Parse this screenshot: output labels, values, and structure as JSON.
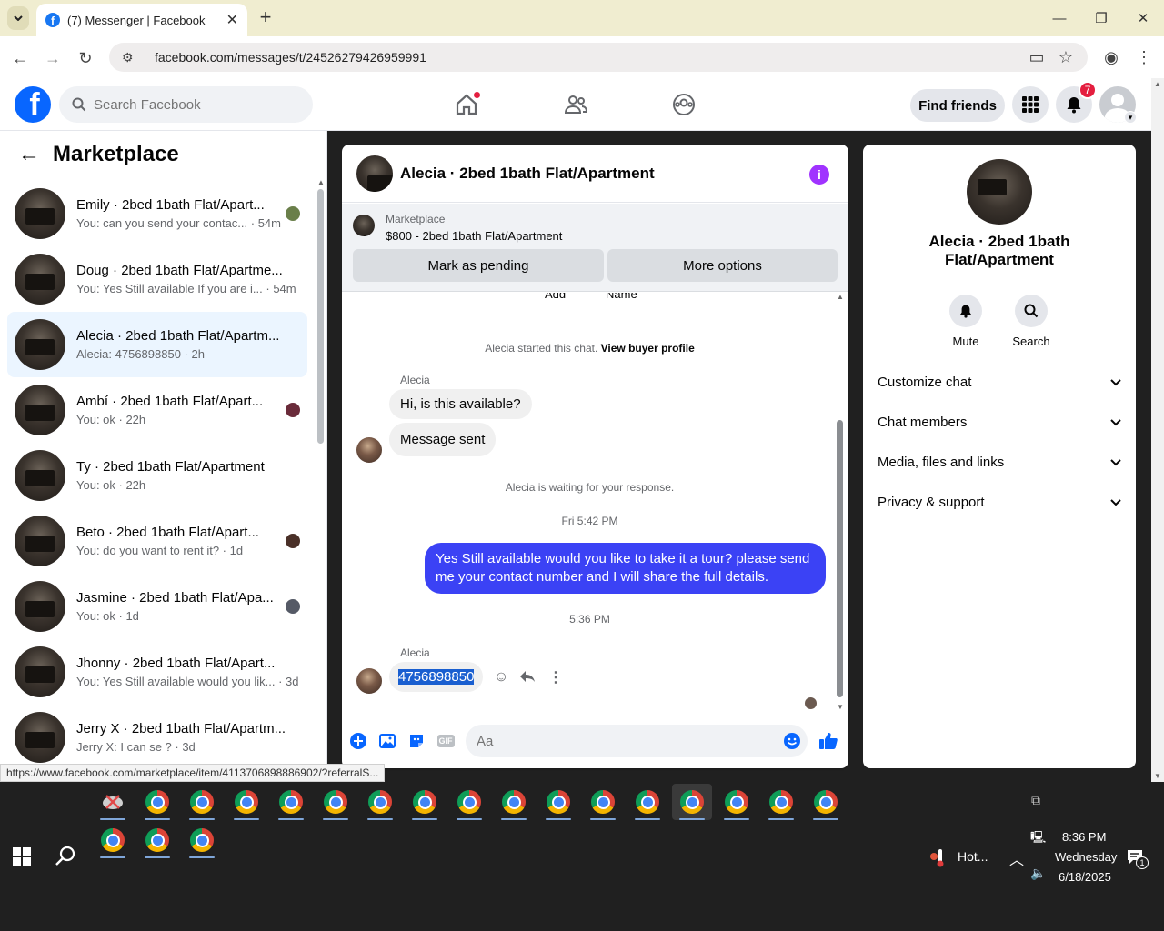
{
  "browser": {
    "tab_title": "(7) Messenger | Facebook",
    "url": "facebook.com/messages/t/24526279426959991",
    "status_url": "https://www.facebook.com/marketplace/item/4113706898886902/?referralS..."
  },
  "fb_header": {
    "search_placeholder": "Search Facebook",
    "find_friends": "Find friends",
    "notification_count": "7"
  },
  "sidebar": {
    "title": "Marketplace",
    "conversations": [
      {
        "name": "Emily · 2bed 1bath Flat/Apart...",
        "preview": "You: can you send your contac... · 54m"
      },
      {
        "name": "Doug · 2bed 1bath Flat/Apartme...",
        "preview": "You: Yes Still available If you are i... · 54m"
      },
      {
        "name": "Alecia · 2bed 1bath Flat/Apartm...",
        "preview": "Alecia: 4756898850 · 2h"
      },
      {
        "name": "Ambí · 2bed 1bath Flat/Apart...",
        "preview": "You: ok · 22h"
      },
      {
        "name": "Ty · 2bed 1bath Flat/Apartment",
        "preview": "You: ok · 22h"
      },
      {
        "name": "Beto · 2bed 1bath Flat/Apart...",
        "preview": "You: do you want to rent it? · 1d"
      },
      {
        "name": "Jasmine · 2bed 1bath Flat/Apa...",
        "preview": "You: ok · 1d"
      },
      {
        "name": "Jhonny · 2bed 1bath Flat/Apart...",
        "preview": "You: Yes Still available would you lik... · 3d"
      },
      {
        "name": "Jerry X · 2bed 1bath Flat/Apartm...",
        "preview": "Jerry X: I can se ? · 3d"
      }
    ]
  },
  "chat": {
    "title": "Alecia · 2bed 1bath Flat/Apartment",
    "marketplace_label": "Marketplace",
    "listing": "$800 - 2bed 1bath Flat/Apartment",
    "mark_pending": "Mark as pending",
    "more_options": "More options",
    "partial_top_left": "Add",
    "partial_top_right": "Name",
    "started_text": "Alecia started this chat.",
    "view_buyer": "View buyer profile",
    "sender": "Alecia",
    "msg1": "Hi, is this available?",
    "msg2": "Message sent",
    "waiting": "Alecia is waiting for your response.",
    "time1": "Fri 5:42 PM",
    "outgoing": "Yes Still available would you like to take it a tour? please send me your contact number and I will share the full details.",
    "time2": "5:36 PM",
    "sender2": "Alecia",
    "phone_msg": "4756898850",
    "input_placeholder": "Aa"
  },
  "right_panel": {
    "name": "Alecia · 2bed 1bath Flat/Apartment",
    "mute": "Mute",
    "search": "Search",
    "sections": [
      "Customize chat",
      "Chat members",
      "Media, files and links",
      "Privacy & support"
    ]
  },
  "taskbar": {
    "weather": "Hot...",
    "time": "8:36 PM",
    "day": "Wednesday",
    "date": "6/18/2025",
    "notif_count": "1"
  },
  "colors": {
    "fb_blue": "#0866ff",
    "outgoing_bubble": "#3b42f5",
    "badge_red": "#e41e3f",
    "info_purple": "#a033ff"
  }
}
